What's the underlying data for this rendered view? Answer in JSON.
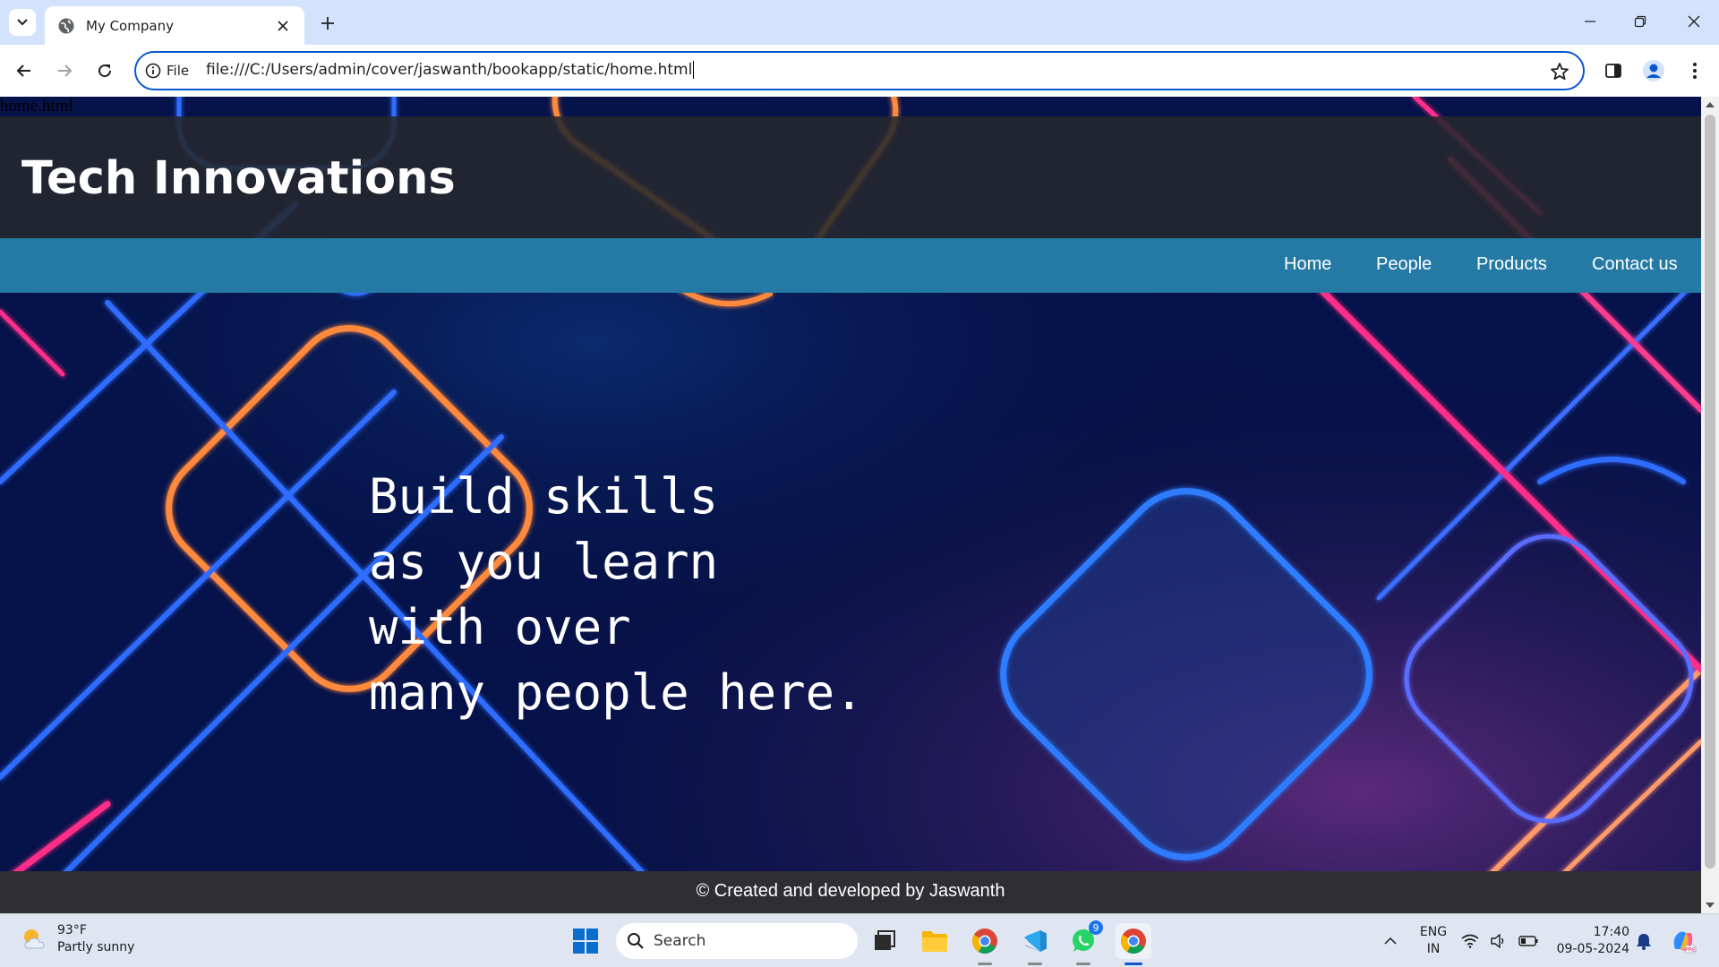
{
  "browser": {
    "tab_title": "My Company",
    "omnibox_chip": "File",
    "url": "file:///C:/Users/admin/cover/jaswanth/bookapp/static/home.html"
  },
  "page": {
    "filename_text": "home.html",
    "site_title": "Tech Innovations",
    "nav": [
      "Home",
      "People",
      "Products",
      "Contact us"
    ],
    "hero_lines": [
      "Build skills",
      "as you learn",
      "with over",
      "many people here."
    ],
    "footer": "© Created and developed by Jaswanth"
  },
  "taskbar": {
    "weather_temp": "93°F",
    "weather_desc": "Partly sunny",
    "search_placeholder": "Search",
    "whatsapp_badge": "9",
    "lang_line1": "ENG",
    "lang_line2": "IN",
    "time": "17:40",
    "date": "09-05-2024"
  },
  "colors": {
    "header_bg": "#26282e",
    "nav_bg": "#2479a5",
    "footer_bg": "#2f2f33",
    "accent": "#0b57d0"
  },
  "icons": [
    "tab-search-icon",
    "globe-icon",
    "close-icon",
    "plus-icon",
    "back-icon",
    "forward-icon",
    "reload-icon",
    "info-icon",
    "star-icon",
    "side-panel-icon",
    "profile-icon",
    "menu-icon",
    "windows-icon",
    "search-icon",
    "task-view-icon",
    "folder-icon",
    "chrome-icon",
    "vscode-icon",
    "whatsapp-icon",
    "wifi-icon",
    "volume-icon",
    "battery-icon",
    "bell-icon",
    "copilot-icon"
  ]
}
